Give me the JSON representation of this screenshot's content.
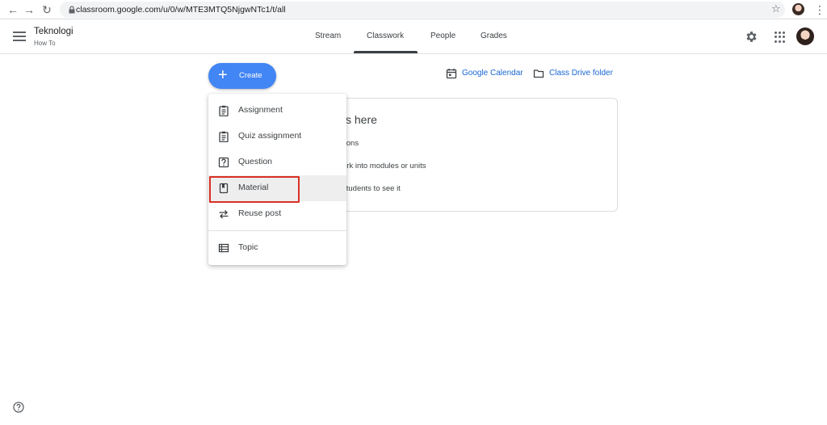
{
  "browser": {
    "back_glyph": "←",
    "forward_glyph": "→",
    "reload_glyph": "↻",
    "url": "classroom.google.com/u/0/w/MTE3MTQ5NjgwNTc1/t/all",
    "star_glyph": "☆",
    "kebab_glyph": "⋮"
  },
  "header": {
    "class_title": "Teknologi",
    "class_subtitle": "How To",
    "tabs": [
      {
        "label": "Stream"
      },
      {
        "label": "Classwork",
        "active": true
      },
      {
        "label": "People"
      },
      {
        "label": "Grades"
      }
    ]
  },
  "create": {
    "plus": "+",
    "label": "Create"
  },
  "links": {
    "calendar": "Google Calendar",
    "drive": "Class Drive folder"
  },
  "card": {
    "heading": "ss here",
    "lines": [
      "tions",
      "ork into modules or units",
      "students to see it"
    ]
  },
  "menu": {
    "items": [
      {
        "label": "Assignment",
        "icon": "assignment-icon"
      },
      {
        "label": "Quiz assignment",
        "icon": "quiz-assignment-icon"
      },
      {
        "label": "Question",
        "icon": "question-icon"
      },
      {
        "label": "Material",
        "icon": "material-icon",
        "highlighted": true
      },
      {
        "label": "Reuse post",
        "icon": "reuse-post-icon"
      },
      {
        "label": "Topic",
        "icon": "topic-icon"
      }
    ]
  },
  "colors": {
    "accent": "#4285f4",
    "link": "#1967d2",
    "highlight_border": "#d93025"
  }
}
